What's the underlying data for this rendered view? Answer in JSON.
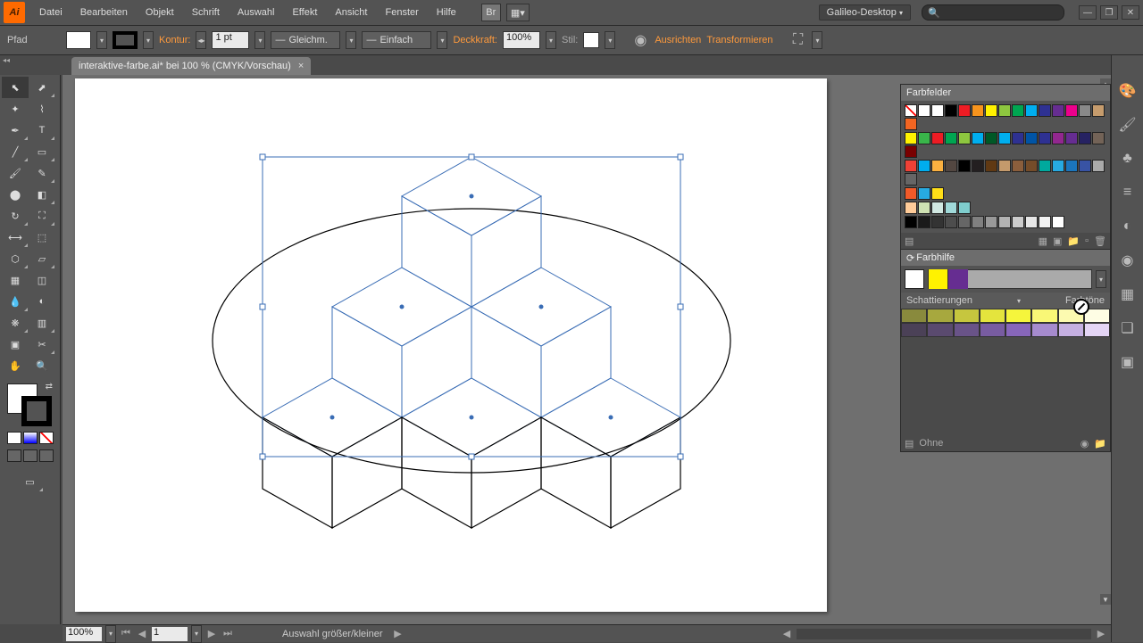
{
  "app": {
    "logo": "Ai"
  },
  "menu": {
    "items": [
      "Datei",
      "Bearbeiten",
      "Objekt",
      "Schrift",
      "Auswahl",
      "Effekt",
      "Ansicht",
      "Fenster",
      "Hilfe"
    ],
    "workspace": "Galileo-Desktop"
  },
  "control": {
    "selection_label": "Pfad",
    "stroke_label": "Kontur:",
    "stroke_weight": "1 pt",
    "brush_label": "Gleichm.",
    "style_label": "Einfach",
    "opacity_label": "Deckkraft:",
    "opacity_value": "100%",
    "graphic_style_label": "Stil:",
    "align_label": "Ausrichten",
    "transform_label": "Transformieren"
  },
  "document": {
    "tab_title": "interaktive-farbe.ai* bei 100 % (CMYK/Vorschau)"
  },
  "panels": {
    "swatches": {
      "title": "Farbfelder",
      "rows": [
        [
          "#ffffff00",
          "#ffffff",
          "#ffffff",
          "#000000",
          "#ed1c24",
          "#f7941d",
          "#fff200",
          "#8dc63f",
          "#00a651",
          "#00aeef",
          "#2e3192",
          "#662d91",
          "#ec008c",
          "#898989",
          "#c69c6d",
          "#f26522"
        ],
        [
          "#fff200",
          "#39b54a",
          "#ed1c24",
          "#00a651",
          "#8dc63f",
          "#00aeef",
          "#005826",
          "#00aeef",
          "#2e3192",
          "#0054a6",
          "#2e3192",
          "#92278f",
          "#662d91",
          "#262262",
          "#736357",
          "#790000"
        ],
        [
          "#ef4136",
          "#00adee",
          "#fbb040",
          "#534741",
          "#000000",
          "#231f20",
          "#603913",
          "#c49a6c",
          "#8b5e3c",
          "#754c29",
          "#00a99d",
          "#27aae1",
          "#1b75bc",
          "#3853a4",
          "#aaaaaa",
          "#666666"
        ],
        [
          "#f15a29",
          "#27aae1",
          "#ffde17"
        ],
        [
          "#ffcc99",
          "#cfe2b3",
          "#d1e8e2",
          "#a0d9d9",
          "#7fcdcd"
        ],
        [
          "#000000",
          "#1a1a1a",
          "#333333",
          "#4d4d4d",
          "#666666",
          "#808080",
          "#999999",
          "#b3b3b3",
          "#cccccc",
          "#e6e6e6",
          "#f2f2f2",
          "#ffffff"
        ]
      ]
    },
    "colorguide": {
      "title": "Farbhilfe",
      "base_colors": [
        "#fff200",
        "#662d91"
      ],
      "mode_label_left": "Schattierungen",
      "mode_label_right": "Farbtöne",
      "tints": {
        "row1": [
          "#898a3d",
          "#a7a83e",
          "#c6c63e",
          "#e4e43d",
          "#f5f53c",
          "#f9f776",
          "#fcfab0",
          "#fefde4"
        ],
        "row2": [
          "#4b4157",
          "#5a4a6f",
          "#695388",
          "#785ca1",
          "#8766ba",
          "#a68bce",
          "#c5b0e2",
          "#e4d5f5"
        ]
      },
      "footer_label": "Ohne"
    }
  },
  "statusbar": {
    "zoom": "100%",
    "page": "1",
    "status_text": "Auswahl größer/kleiner"
  }
}
